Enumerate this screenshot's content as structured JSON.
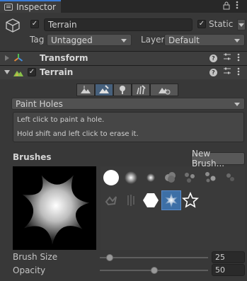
{
  "window": {
    "tab_label": "Inspector"
  },
  "header": {
    "object_name": "Terrain",
    "active_checked": true,
    "static_checked": true,
    "static_label": "Static",
    "tag_label": "Tag",
    "tag_value": "Untagged",
    "layer_label": "Layer",
    "layer_value": "Default"
  },
  "components": [
    {
      "title": "Transform",
      "expanded": false,
      "icon": "transform-axes-icon"
    },
    {
      "title": "Terrain",
      "expanded": true,
      "icon": "terrain-icon",
      "enabled": true
    }
  ],
  "terrain": {
    "tools": [
      {
        "icon": "raise-lower-terrain-icon",
        "selected": false
      },
      {
        "icon": "paint-terrain-icon",
        "selected": true
      },
      {
        "icon": "paint-trees-icon",
        "selected": false
      },
      {
        "icon": "paint-details-icon",
        "selected": false
      },
      {
        "icon": "terrain-settings-icon",
        "selected": false
      }
    ],
    "mode_value": "Paint Holes",
    "help_lines": [
      "Left click to paint a hole.",
      "Hold shift and left click to erase it."
    ],
    "brushes_label": "Brushes",
    "new_brush_label": "New Brush...",
    "brush_size_label": "Brush Size",
    "brush_size_value": "25",
    "brush_size_fraction": 0.09,
    "opacity_label": "Opacity",
    "opacity_value": "50",
    "opacity_fraction": 0.5
  },
  "colors": {
    "accent": "#3a7bd5",
    "selected_tool": "#46607c",
    "selected_brush": "#3d6fa6"
  }
}
